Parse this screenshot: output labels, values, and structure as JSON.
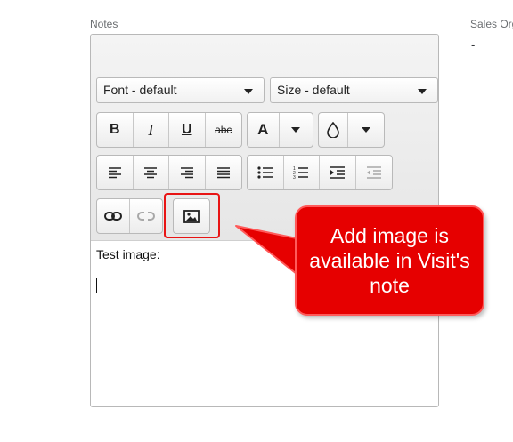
{
  "notes_label": "Notes",
  "sales_label": "Sales Org",
  "sales_value": "-",
  "toolbar": {
    "font_select": "Font - default",
    "size_select": "Size - default",
    "bold": "B",
    "italic": "I",
    "underline": "U",
    "strike": "abc",
    "font_color": "A"
  },
  "editor_text": "Test image:",
  "callout_text": "Add image is available in Visit's note",
  "colors": {
    "highlight": "#e81414",
    "callout": "#e60000"
  }
}
